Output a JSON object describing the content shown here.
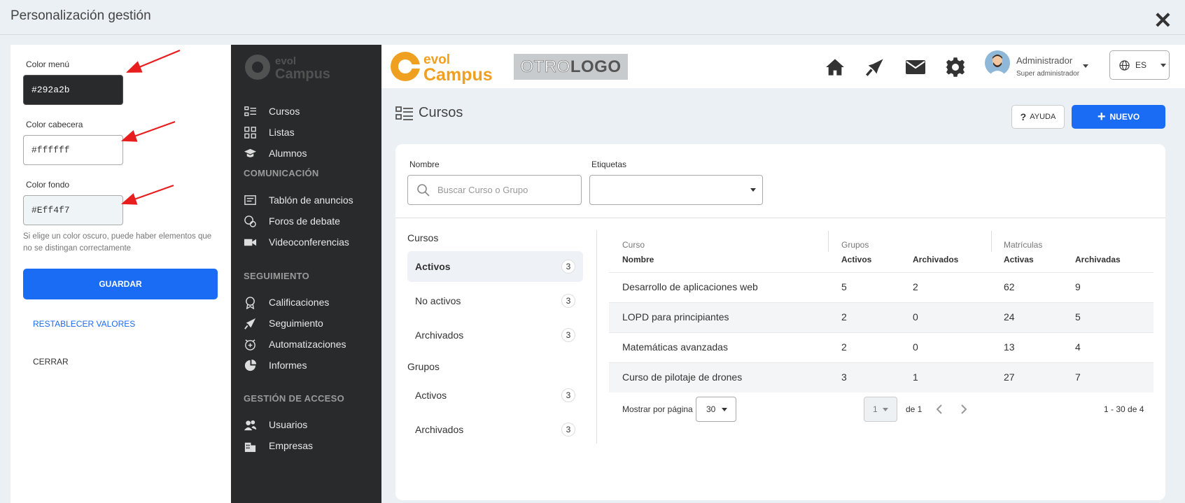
{
  "modal": {
    "title": "Personalización gestión",
    "close": "✕"
  },
  "settings": {
    "menu_label": "Color menú",
    "menu_value": "#292a2b",
    "header_label": "Color cabecera",
    "header_value": "#ffffff",
    "bg_label": "Color fondo",
    "bg_value": "#Eff4f7",
    "hint": "Si elige un color oscuro, puede haber elementos que no se distingan correctamente",
    "save": "GUARDAR",
    "reset": "RESTABLECER VALORES",
    "close": "CERRAR"
  },
  "colors": {
    "menu": "#292a2b",
    "header": "#ffffff",
    "background": "#ebf0f4",
    "primary": "#1a6cf5",
    "annotation": "#e81e1e"
  },
  "sidebar": {
    "logo_top": "evol",
    "logo_bottom": "Campus",
    "items1": [
      {
        "label": "Cursos",
        "icon": "list-icon"
      },
      {
        "label": "Listas",
        "icon": "grid-icon"
      },
      {
        "label": "Alumnos",
        "icon": "graduation-cap-icon"
      }
    ],
    "sec1": "COMUNICACIÓN",
    "items2": [
      {
        "label": "Tablón de anuncios",
        "icon": "board-icon"
      },
      {
        "label": "Foros de debate",
        "icon": "forum-icon"
      },
      {
        "label": "Videoconferencias",
        "icon": "video-icon"
      }
    ],
    "sec2": "SEGUIMIENTO",
    "items3": [
      {
        "label": "Calificaciones",
        "icon": "award-icon"
      },
      {
        "label": "Seguimiento",
        "icon": "rocket-icon"
      },
      {
        "label": "Automatizaciones",
        "icon": "clock-plus-icon"
      },
      {
        "label": "Informes",
        "icon": "pie-chart-icon"
      }
    ],
    "sec3": "GESTIÓN DE ACCESO",
    "items4": [
      {
        "label": "Usuarios",
        "icon": "users-icon"
      },
      {
        "label": "Empresas",
        "icon": "building-icon"
      }
    ]
  },
  "topbar": {
    "logo_top": "evol",
    "logo_bottom": "Campus",
    "otrologo_a": "OTRO",
    "otrologo_b": "LOGO",
    "user_name": "Administrador",
    "user_role": "Super administrador",
    "lang": "ES"
  },
  "page": {
    "title": "Cursos",
    "help": "AYUDA",
    "new": "NUEVO"
  },
  "filters": {
    "name_label": "Nombre",
    "search_placeholder": "Buscar Curso o Grupo",
    "tags_label": "Etiquetas"
  },
  "facets": {
    "courses_title": "Cursos",
    "courses": [
      {
        "label": "Activos",
        "count": "3"
      },
      {
        "label": "No activos",
        "count": "3"
      },
      {
        "label": "Archivados",
        "count": "3"
      }
    ],
    "groups_title": "Grupos",
    "groups": [
      {
        "label": "Activos",
        "count": "3"
      },
      {
        "label": "Archivados",
        "count": "3"
      }
    ]
  },
  "table": {
    "group_curso": "Curso",
    "group_grupos": "Grupos",
    "group_matriculas": "Matrículas",
    "col_nombre": "Nombre",
    "col_g_activos": "Activos",
    "col_g_archivados": "Archivados",
    "col_m_activas": "Activas",
    "col_m_archivadas": "Archivadas",
    "rows": [
      [
        "Desarrollo de aplicaciones web",
        "5",
        "2",
        "62",
        "9"
      ],
      [
        "LOPD para principiantes",
        "2",
        "0",
        "24",
        "5"
      ],
      [
        "Matemáticas avanzadas",
        "2",
        "0",
        "13",
        "4"
      ],
      [
        "Curso de pilotaje de drones",
        "3",
        "1",
        "27",
        "7"
      ]
    ]
  },
  "pagination": {
    "per_page_label": "Mostrar por página",
    "per_page": "30",
    "page": "1",
    "of": "de 1",
    "range": "1 - 30 de 4"
  }
}
